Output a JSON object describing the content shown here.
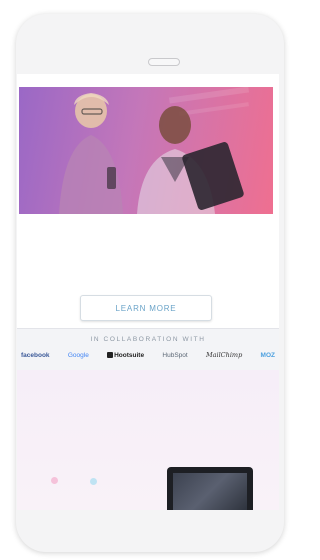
{
  "hero": {
    "image_description_icon": "people-with-tablet-photo",
    "gradient_colors": [
      "#9a68c6",
      "#c477b9",
      "#ef6f90"
    ]
  },
  "cta": {
    "learn_more_label": "LEARN MORE",
    "accent_color": "#6aa3c8"
  },
  "collaboration": {
    "title": "IN COLLABORATION WITH",
    "logos": [
      {
        "name": "facebook-logo",
        "text": "facebook"
      },
      {
        "name": "google-logo",
        "text": "Google"
      },
      {
        "name": "hootsuite-logo",
        "text": "Hootsuite"
      },
      {
        "name": "hubspot-logo",
        "text": "HubSpot"
      },
      {
        "name": "mailchimp-logo",
        "text": "MailChimp"
      },
      {
        "name": "moz-logo",
        "text": "MOZ"
      }
    ]
  },
  "lower": {
    "laptop_icon": "laptop-icon"
  }
}
